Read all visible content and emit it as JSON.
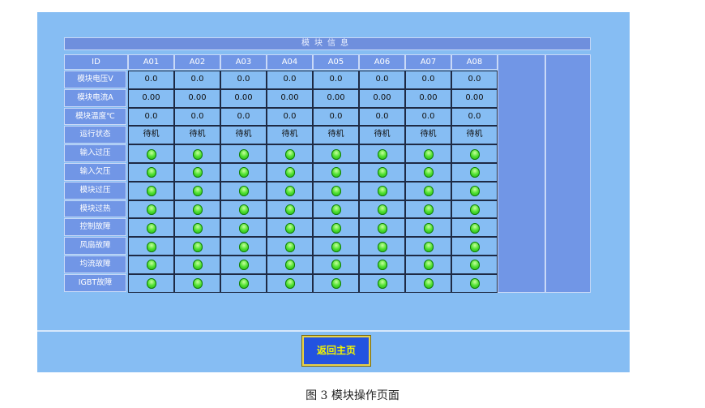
{
  "panel": {
    "title": "模块信息",
    "id_label": "ID",
    "columns": [
      "A01",
      "A02",
      "A03",
      "A04",
      "A05",
      "A06",
      "A07",
      "A08"
    ],
    "value_rows": [
      {
        "label": "模块电压V",
        "values": [
          "0.0",
          "0.0",
          "0.0",
          "0.0",
          "0.0",
          "0.0",
          "0.0",
          "0.0"
        ]
      },
      {
        "label": "模块电流A",
        "values": [
          "0.00",
          "0.00",
          "0.00",
          "0.00",
          "0.00",
          "0.00",
          "0.00",
          "0.00"
        ]
      },
      {
        "label": "模块温度℃",
        "values": [
          "0.0",
          "0.0",
          "0.0",
          "0.0",
          "0.0",
          "0.0",
          "0.0",
          "0.0"
        ]
      },
      {
        "label": "运行状态",
        "values": [
          "待机",
          "待机",
          "待机",
          "待机",
          "待机",
          "待机",
          "待机",
          "待机"
        ]
      }
    ],
    "indicator_rows": [
      "输入过压",
      "输入欠压",
      "模块过压",
      "模块过热",
      "控制故障",
      "风扇故障",
      "均流故障",
      "IGBT故障"
    ],
    "indicator_color": "#4fe031"
  },
  "footer": {
    "home_button": "返回主页"
  },
  "caption": "图 3  模块操作页面"
}
